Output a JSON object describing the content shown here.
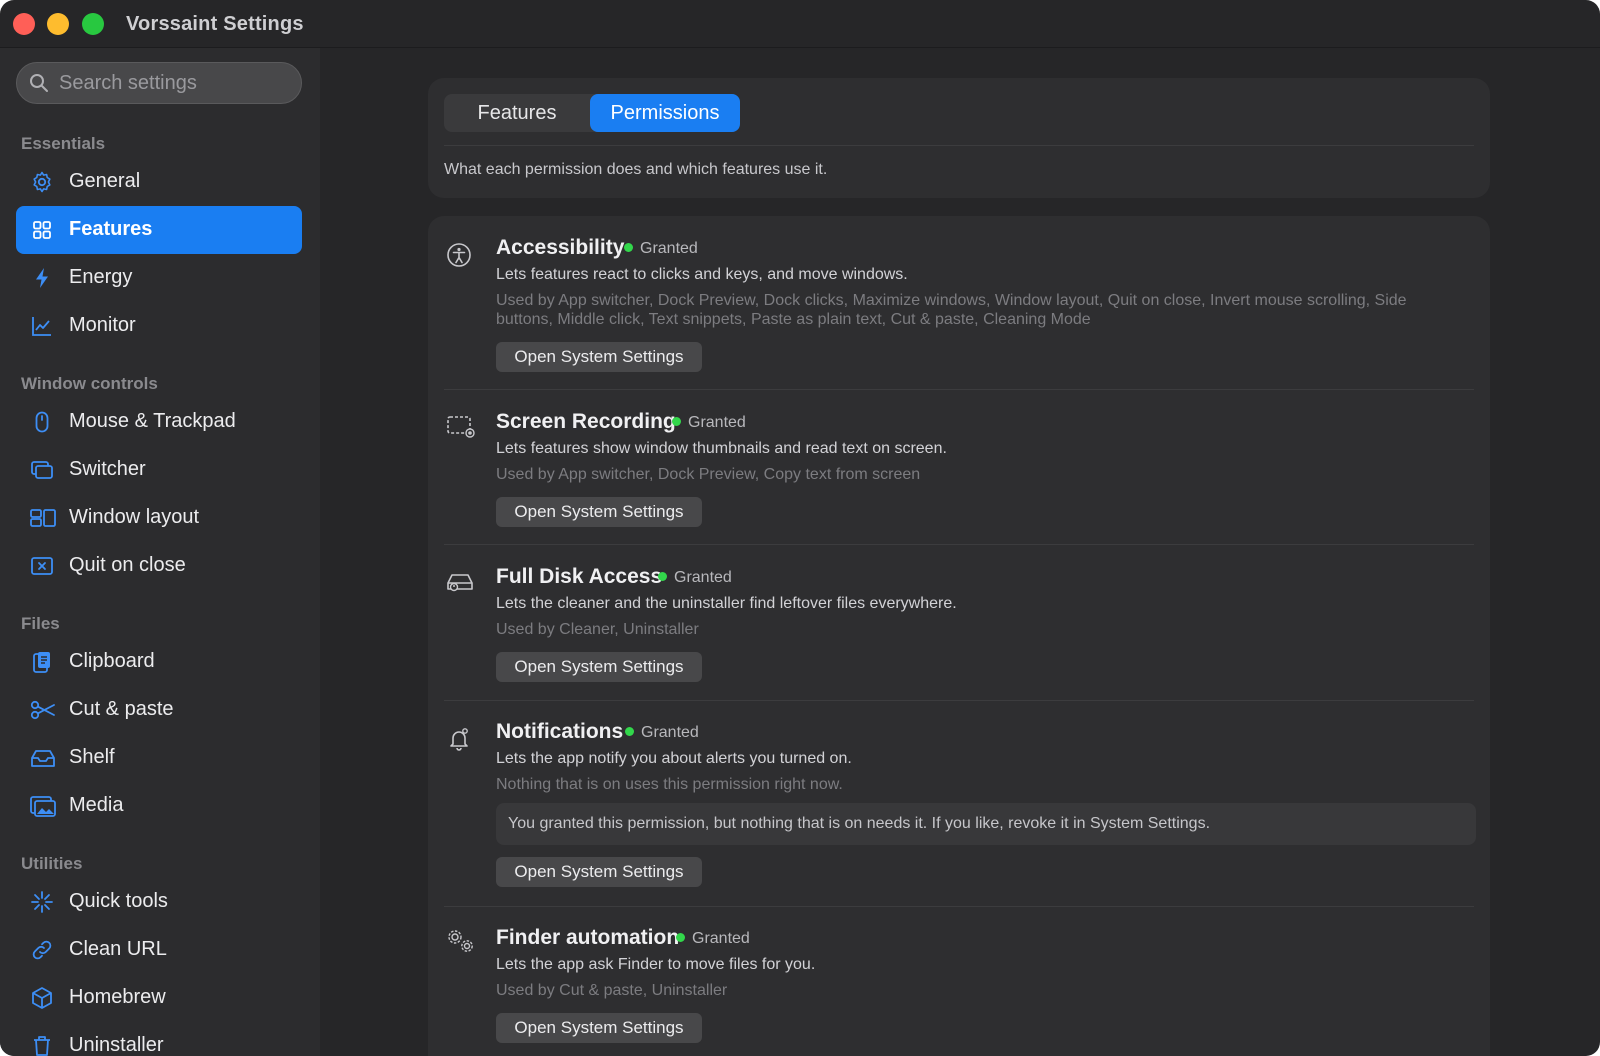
{
  "window": {
    "title": "Vorssaint Settings"
  },
  "search": {
    "placeholder": "Search settings"
  },
  "sidebar": {
    "sections": [
      {
        "label": "Essentials"
      },
      {
        "label": "Window controls"
      },
      {
        "label": "Files"
      },
      {
        "label": "Utilities"
      }
    ],
    "items": [
      {
        "label": "General",
        "icon": "gear-icon"
      },
      {
        "label": "Features",
        "icon": "grid-icon",
        "active": true
      },
      {
        "label": "Energy",
        "icon": "bolt-icon"
      },
      {
        "label": "Monitor",
        "icon": "chart-icon"
      },
      {
        "label": "Mouse & Trackpad",
        "icon": "mouse-icon"
      },
      {
        "label": "Switcher",
        "icon": "windows-icon"
      },
      {
        "label": "Window layout",
        "icon": "layout-icon"
      },
      {
        "label": "Quit on close",
        "icon": "close-box-icon"
      },
      {
        "label": "Clipboard",
        "icon": "clipboard-icon"
      },
      {
        "label": "Cut & paste",
        "icon": "scissors-icon"
      },
      {
        "label": "Shelf",
        "icon": "tray-icon"
      },
      {
        "label": "Media",
        "icon": "photo-icon"
      },
      {
        "label": "Quick tools",
        "icon": "sparkle-icon"
      },
      {
        "label": "Clean URL",
        "icon": "link-icon"
      },
      {
        "label": "Homebrew",
        "icon": "package-icon"
      },
      {
        "label": "Uninstaller",
        "icon": "trash-icon"
      }
    ]
  },
  "tabs": [
    {
      "label": "Features",
      "active": false
    },
    {
      "label": "Permissions",
      "active": true
    }
  ],
  "intro": "What each permission does and which features use it.",
  "accent_color": "#1a7ef2",
  "granted_color": "#32d74b",
  "permissions": [
    {
      "title": "Accessibility",
      "status": "Granted",
      "icon": "accessibility-icon",
      "description": "Lets features react to clicks and keys, and move windows.",
      "used_by": "Used by App switcher, Dock Preview, Dock clicks, Maximize windows, Window layout, Quit on close, Invert mouse scrolling, Side buttons, Middle click, Text snippets, Paste as plain text, Cut & paste, Cleaning Mode",
      "button": "Open System Settings"
    },
    {
      "title": "Screen Recording",
      "status": "Granted",
      "icon": "screen-recording-icon",
      "description": "Lets features show window thumbnails and read text on screen.",
      "used_by": "Used by App switcher, Dock Preview, Copy text from screen",
      "button": "Open System Settings"
    },
    {
      "title": "Full Disk Access",
      "status": "Granted",
      "icon": "disk-icon",
      "description": "Lets the cleaner and the uninstaller find leftover files everywhere.",
      "used_by": "Used by Cleaner, Uninstaller",
      "button": "Open System Settings"
    },
    {
      "title": "Notifications",
      "status": "Granted",
      "icon": "bell-icon",
      "description": "Lets the app notify you about alerts you turned on.",
      "used_by": "Nothing that is on uses this permission right now.",
      "note": "You granted this permission, but nothing that is on needs it. If you like, revoke it in System Settings.",
      "button": "Open System Settings"
    },
    {
      "title": "Finder automation",
      "status": "Granted",
      "icon": "gears-icon",
      "description": "Lets the app ask Finder to move files for you.",
      "used_by": "Used by Cut & paste, Uninstaller",
      "button": "Open System Settings"
    }
  ]
}
